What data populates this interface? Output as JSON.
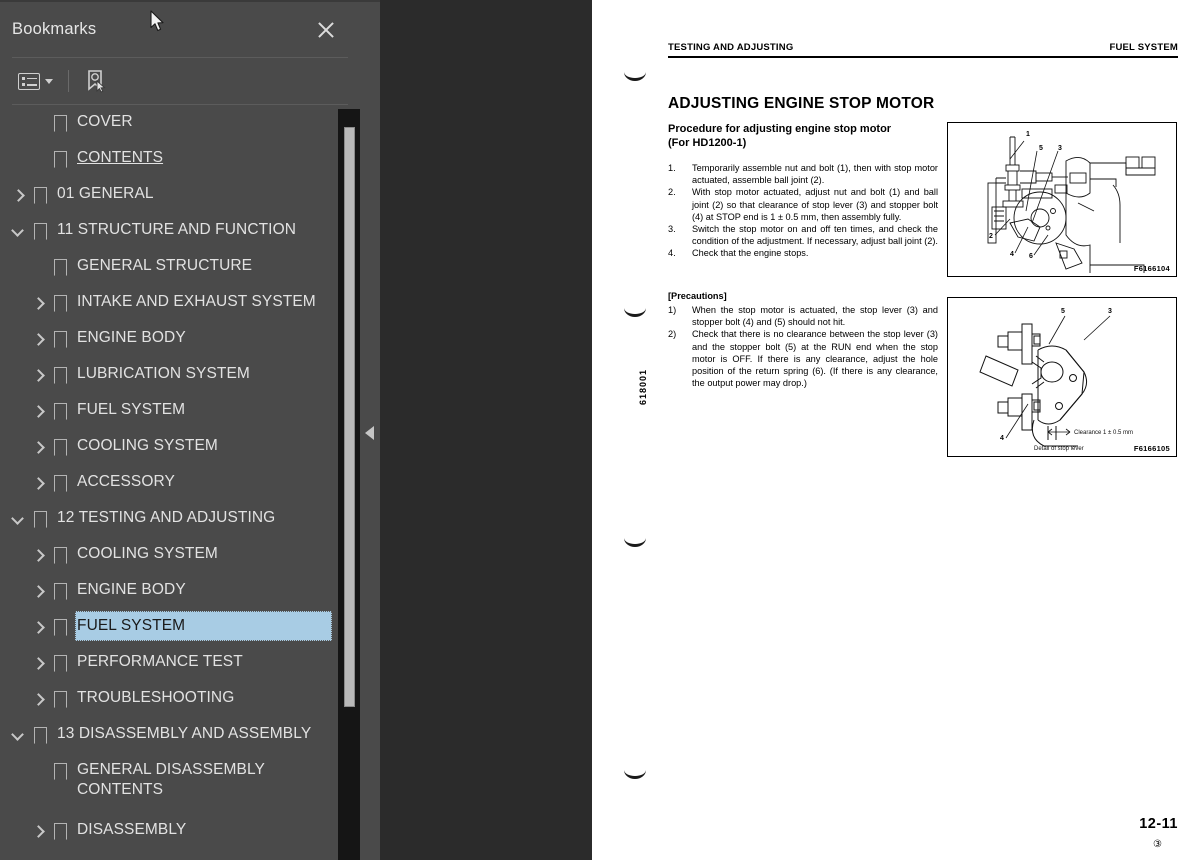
{
  "panel": {
    "title": "Bookmarks",
    "close_label": "×",
    "toolbar": {
      "options_icon": "list-options-icon",
      "options_caret": "chevron-down-icon",
      "new_bookmark_icon": "bookmark-cursor-icon"
    },
    "tree": [
      {
        "label": "COVER",
        "depth": 1,
        "twisty": "none",
        "underline": false,
        "selected": false
      },
      {
        "label": "CONTENTS",
        "depth": 1,
        "twisty": "none",
        "underline": true,
        "selected": false
      },
      {
        "label": "01 GENERAL",
        "depth": 0,
        "twisty": "collapsed",
        "underline": false,
        "selected": false
      },
      {
        "label": "11 STRUCTURE AND FUNCTION",
        "depth": 0,
        "twisty": "expanded",
        "underline": false,
        "selected": false
      },
      {
        "label": "GENERAL STRUCTURE",
        "depth": 1,
        "twisty": "none",
        "underline": false,
        "selected": false
      },
      {
        "label": "INTAKE AND EXHAUST SYSTEM",
        "depth": 1,
        "twisty": "collapsed",
        "underline": false,
        "selected": false
      },
      {
        "label": "ENGINE BODY",
        "depth": 1,
        "twisty": "collapsed",
        "underline": false,
        "selected": false
      },
      {
        "label": "LUBRICATION SYSTEM",
        "depth": 1,
        "twisty": "collapsed",
        "underline": false,
        "selected": false
      },
      {
        "label": "FUEL SYSTEM",
        "depth": 1,
        "twisty": "collapsed",
        "underline": false,
        "selected": false
      },
      {
        "label": "COOLING SYSTEM",
        "depth": 1,
        "twisty": "collapsed",
        "underline": false,
        "selected": false
      },
      {
        "label": "ACCESSORY",
        "depth": 1,
        "twisty": "collapsed",
        "underline": false,
        "selected": false
      },
      {
        "label": "12 TESTING AND ADJUSTING",
        "depth": 0,
        "twisty": "expanded",
        "underline": false,
        "selected": false
      },
      {
        "label": "COOLING SYSTEM",
        "depth": 1,
        "twisty": "collapsed",
        "underline": false,
        "selected": false
      },
      {
        "label": "ENGINE BODY",
        "depth": 1,
        "twisty": "collapsed",
        "underline": false,
        "selected": false
      },
      {
        "label": "FUEL SYSTEM",
        "depth": 1,
        "twisty": "collapsed",
        "underline": false,
        "selected": true
      },
      {
        "label": "PERFORMANCE TEST",
        "depth": 1,
        "twisty": "collapsed",
        "underline": false,
        "selected": false
      },
      {
        "label": "TROUBLESHOOTING",
        "depth": 1,
        "twisty": "collapsed",
        "underline": false,
        "selected": false
      },
      {
        "label": "13 DISASSEMBLY AND ASSEMBLY",
        "depth": 0,
        "twisty": "expanded",
        "underline": false,
        "selected": false
      },
      {
        "label": "GENERAL DISASSEMBLY\nCONTENTS",
        "depth": 1,
        "twisty": "none",
        "underline": false,
        "selected": false,
        "two_line": true
      },
      {
        "label": "DISASSEMBLY",
        "depth": 1,
        "twisty": "collapsed",
        "underline": false,
        "selected": false
      }
    ],
    "collapse_handle_icon": "collapse-left-triangle-icon",
    "selection_color": "#a8cce4"
  },
  "document": {
    "header_left": "TESTING AND ADJUSTING",
    "header_right": "FUEL SYSTEM",
    "heading": "ADJUSTING ENGINE STOP MOTOR",
    "subheading": "Procedure for adjusting engine stop motor\n(For HD1200-1)",
    "procedure": [
      {
        "num": "1.",
        "text": "Temporarily assemble nut and bolt (1), then with stop motor actuated, assemble ball joint (2)."
      },
      {
        "num": "2.",
        "text": "With stop motor actuated, adjust nut and bolt (1) and ball joint (2) so that clearance of stop lever (3) and stopper bolt (4) at STOP end is 1 ± 0.5 mm, then assembly fully."
      },
      {
        "num": "3.",
        "text": "Switch the stop motor on and off ten times, and check the condition of the adjustment.  If necessary, adjust ball joint (2)."
      },
      {
        "num": "4.",
        "text": "Check that the engine stops."
      }
    ],
    "precautions_title": "[Precautions]",
    "precautions": [
      {
        "num": "1)",
        "text": "When the stop motor is actuated, the stop lever (3) and stopper bolt (4) and (5) should not hit."
      },
      {
        "num": "2)",
        "text": "Check that there is no clearance between the stop lever (3) and the stopper bolt (5) at the RUN end when the stop motor is OFF.  If there is any clearance, adjust the hole position of the return spring (6).  (If there is any clearance, the output power may drop.)"
      }
    ],
    "figure1": {
      "id": "F6166104",
      "callouts": [
        "1",
        "5",
        "3",
        "2",
        "4",
        "6"
      ]
    },
    "figure2": {
      "id": "F6166105",
      "callouts": [
        "5",
        "3",
        "4"
      ],
      "clearance_note": "Clearance 1 ± 0.5 mm",
      "caption": "Detail of stop lever"
    },
    "side_code": "618001",
    "page_number": "12-11",
    "page_sub": "③"
  }
}
